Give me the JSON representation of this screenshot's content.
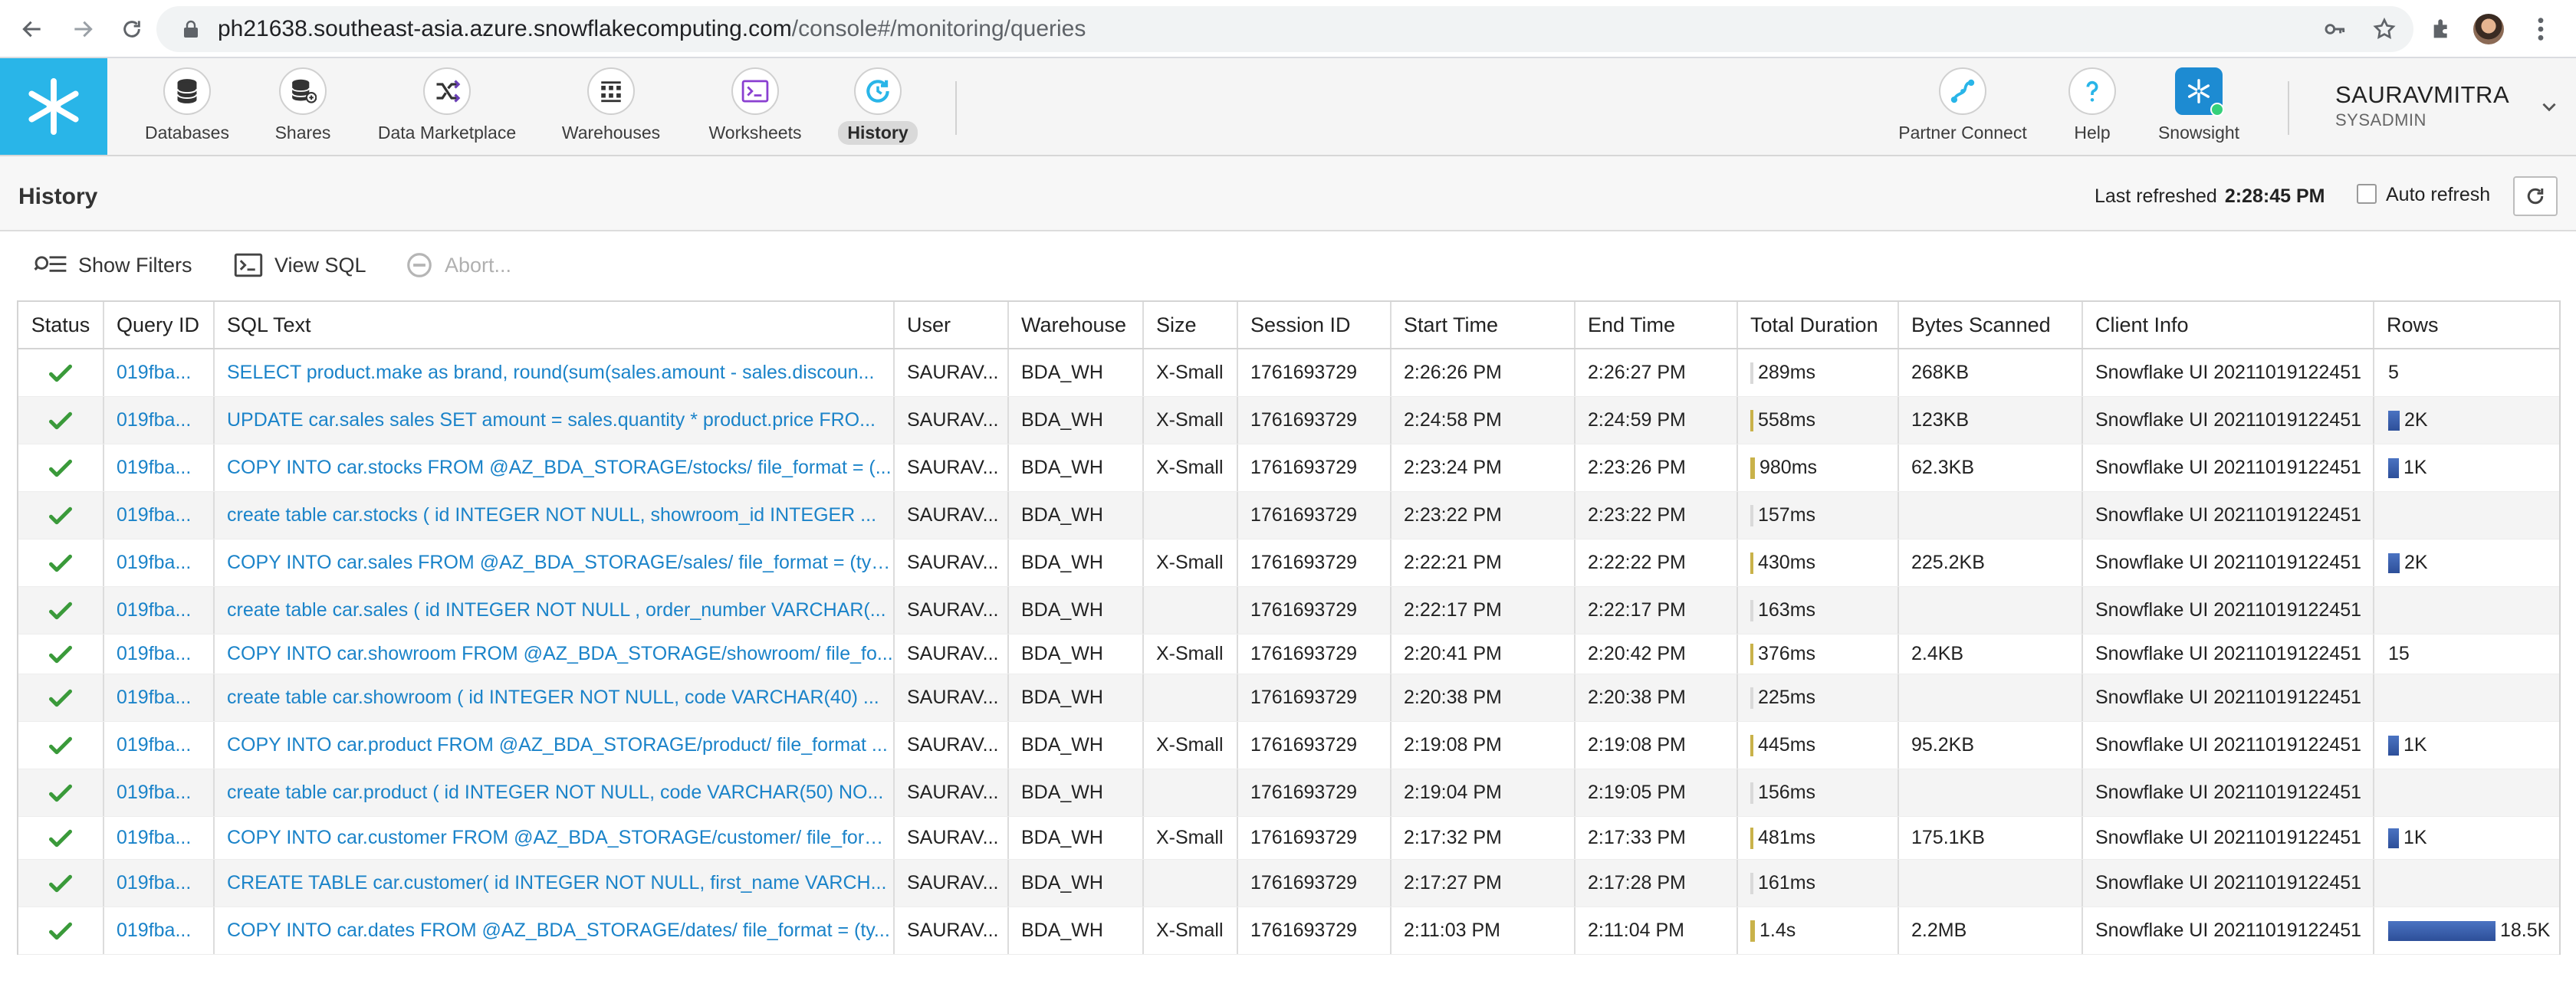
{
  "browser": {
    "url_host": "ph21638.southeast-asia.azure.snowflakecomputing.com",
    "url_path": "/console#/monitoring/queries"
  },
  "nav": {
    "items": [
      {
        "label": "Databases",
        "icon": "database-icon"
      },
      {
        "label": "Shares",
        "icon": "share-icon"
      },
      {
        "label": "Data Marketplace",
        "icon": "marketplace-icon"
      },
      {
        "label": "Warehouses",
        "icon": "warehouse-icon"
      },
      {
        "label": "Worksheets",
        "icon": "worksheet-icon"
      },
      {
        "label": "History",
        "icon": "history-icon",
        "active": true
      }
    ],
    "right_items": [
      {
        "label": "Partner Connect",
        "icon": "partner-connect-icon"
      },
      {
        "label": "Help",
        "icon": "help-icon"
      },
      {
        "label": "Snowsight",
        "icon": "snowsight-icon"
      }
    ],
    "user_name": "SAURAVMITRA",
    "user_role": "SYSADMIN"
  },
  "header": {
    "title": "History",
    "last_refreshed_label": "Last refreshed",
    "last_refreshed_time": "2:28:45 PM",
    "auto_refresh_label": "Auto refresh"
  },
  "toolbar": {
    "show_filters": "Show Filters",
    "view_sql": "View SQL",
    "abort": "Abort..."
  },
  "table": {
    "columns": [
      "Status",
      "Query ID",
      "SQL Text",
      "User",
      "Warehouse",
      "Size",
      "Session ID",
      "Start Time",
      "End Time",
      "Total Duration",
      "Bytes Scanned",
      "Client Info",
      "Rows"
    ],
    "rows": [
      {
        "query_id": "019fba...",
        "sql": "SELECT product.make as brand, round(sum(sales.amount - sales.discoun...",
        "user": "SAURAV...",
        "warehouse": "BDA_WH",
        "size": "X-Small",
        "session": "1761693729",
        "start": "2:26:26 PM",
        "end": "2:26:27 PM",
        "duration": "289ms",
        "duration_ms": 289,
        "bytes": "268KB",
        "client": "Snowflake UI 20211019122451",
        "rows": "5",
        "rows_count": 5
      },
      {
        "query_id": "019fba...",
        "sql": "UPDATE car.sales sales SET amount = sales.quantity * product.price FRO...",
        "user": "SAURAV...",
        "warehouse": "BDA_WH",
        "size": "X-Small",
        "session": "1761693729",
        "start": "2:24:58 PM",
        "end": "2:24:59 PM",
        "duration": "558ms",
        "duration_ms": 558,
        "bytes": "123KB",
        "client": "Snowflake UI 20211019122451",
        "rows": "2K",
        "rows_count": 2000
      },
      {
        "query_id": "019fba...",
        "sql": "COPY INTO car.stocks FROM @AZ_BDA_STORAGE/stocks/ file_format = (...",
        "user": "SAURAV...",
        "warehouse": "BDA_WH",
        "size": "X-Small",
        "session": "1761693729",
        "start": "2:23:24 PM",
        "end": "2:23:26 PM",
        "duration": "980ms",
        "duration_ms": 980,
        "bytes": "62.3KB",
        "client": "Snowflake UI 20211019122451",
        "rows": "1K",
        "rows_count": 1000
      },
      {
        "query_id": "019fba...",
        "sql": "create table car.stocks ( id INTEGER NOT NULL, showroom_id INTEGER ...",
        "user": "SAURAV...",
        "warehouse": "BDA_WH",
        "size": "",
        "session": "1761693729",
        "start": "2:23:22 PM",
        "end": "2:23:22 PM",
        "duration": "157ms",
        "duration_ms": 157,
        "bytes": "",
        "client": "Snowflake UI 20211019122451",
        "rows": "",
        "rows_count": 0
      },
      {
        "query_id": "019fba...",
        "sql": "COPY INTO car.sales FROM @AZ_BDA_STORAGE/sales/ file_format = (typ...",
        "user": "SAURAV...",
        "warehouse": "BDA_WH",
        "size": "X-Small",
        "session": "1761693729",
        "start": "2:22:21 PM",
        "end": "2:22:22 PM",
        "duration": "430ms",
        "duration_ms": 430,
        "bytes": "225.2KB",
        "client": "Snowflake UI 20211019122451",
        "rows": "2K",
        "rows_count": 2000
      },
      {
        "query_id": "019fba...",
        "sql": "create table car.sales ( id INTEGER NOT NULL , order_number VARCHAR(...",
        "user": "SAURAV...",
        "warehouse": "BDA_WH",
        "size": "",
        "session": "1761693729",
        "start": "2:22:17 PM",
        "end": "2:22:17 PM",
        "duration": "163ms",
        "duration_ms": 163,
        "bytes": "",
        "client": "Snowflake UI 20211019122451",
        "rows": "",
        "rows_count": 0
      },
      {
        "query_id": "019fba...",
        "sql": "COPY INTO car.showroom FROM @AZ_BDA_STORAGE/showroom/ file_fo...",
        "user": "SAURAV...",
        "warehouse": "BDA_WH",
        "size": "X-Small",
        "session": "1761693729",
        "start": "2:20:41 PM",
        "end": "2:20:42 PM",
        "duration": "376ms",
        "duration_ms": 376,
        "bytes": "2.4KB",
        "client": "Snowflake UI 20211019122451",
        "rows": "15",
        "rows_count": 15
      },
      {
        "query_id": "019fba...",
        "sql": "create table car.showroom ( id INTEGER NOT NULL, code VARCHAR(40) ...",
        "user": "SAURAV...",
        "warehouse": "BDA_WH",
        "size": "",
        "session": "1761693729",
        "start": "2:20:38 PM",
        "end": "2:20:38 PM",
        "duration": "225ms",
        "duration_ms": 225,
        "bytes": "",
        "client": "Snowflake UI 20211019122451",
        "rows": "",
        "rows_count": 0
      },
      {
        "query_id": "019fba...",
        "sql": "COPY INTO car.product FROM @AZ_BDA_STORAGE/product/ file_format ...",
        "user": "SAURAV...",
        "warehouse": "BDA_WH",
        "size": "X-Small",
        "session": "1761693729",
        "start": "2:19:08 PM",
        "end": "2:19:08 PM",
        "duration": "445ms",
        "duration_ms": 445,
        "bytes": "95.2KB",
        "client": "Snowflake UI 20211019122451",
        "rows": "1K",
        "rows_count": 1000
      },
      {
        "query_id": "019fba...",
        "sql": "create table car.product ( id INTEGER NOT NULL, code VARCHAR(50) NO...",
        "user": "SAURAV...",
        "warehouse": "BDA_WH",
        "size": "",
        "session": "1761693729",
        "start": "2:19:04 PM",
        "end": "2:19:05 PM",
        "duration": "156ms",
        "duration_ms": 156,
        "bytes": "",
        "client": "Snowflake UI 20211019122451",
        "rows": "",
        "rows_count": 0
      },
      {
        "query_id": "019fba...",
        "sql": "COPY INTO car.customer FROM @AZ_BDA_STORAGE/customer/ file_form...",
        "user": "SAURAV...",
        "warehouse": "BDA_WH",
        "size": "X-Small",
        "session": "1761693729",
        "start": "2:17:32 PM",
        "end": "2:17:33 PM",
        "duration": "481ms",
        "duration_ms": 481,
        "bytes": "175.1KB",
        "client": "Snowflake UI 20211019122451",
        "rows": "1K",
        "rows_count": 1000
      },
      {
        "query_id": "019fba...",
        "sql": "CREATE TABLE car.customer( id INTEGER NOT NULL, first_name VARCH...",
        "user": "SAURAV...",
        "warehouse": "BDA_WH",
        "size": "",
        "session": "1761693729",
        "start": "2:17:27 PM",
        "end": "2:17:28 PM",
        "duration": "161ms",
        "duration_ms": 161,
        "bytes": "",
        "client": "Snowflake UI 20211019122451",
        "rows": "",
        "rows_count": 0
      },
      {
        "query_id": "019fba...",
        "sql": "COPY INTO car.dates FROM @AZ_BDA_STORAGE/dates/ file_format = (ty...",
        "user": "SAURAV...",
        "warehouse": "BDA_WH",
        "size": "X-Small",
        "session": "1761693729",
        "start": "2:11:03 PM",
        "end": "2:11:04 PM",
        "duration": "1.4s",
        "duration_ms": 1400,
        "bytes": "2.2MB",
        "client": "Snowflake UI 20211019122451",
        "rows": "18.5K",
        "rows_count": 18500
      }
    ]
  },
  "colors": {
    "snowflake_blue": "#29b5e8",
    "link": "#1a83c9",
    "success": "#3a9a3a",
    "rows_bar": "#2d4f99"
  }
}
